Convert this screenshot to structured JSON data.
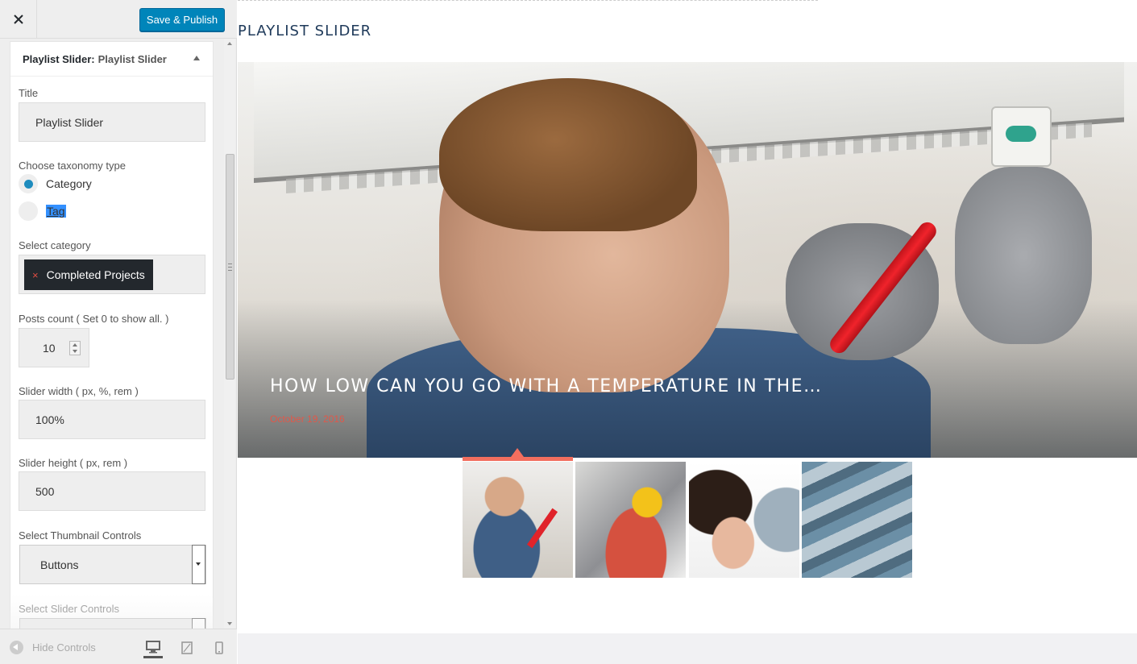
{
  "topbar": {
    "close_icon": "close-icon",
    "publish_label": "Save & Publish"
  },
  "widget": {
    "type_label": "Playlist Slider:",
    "title_label": "Playlist Slider",
    "fields": {
      "title_label": "Title",
      "title_value": "Playlist Slider",
      "taxonomy_label": "Choose taxonomy type",
      "taxonomy_options": [
        "Category",
        "Tag"
      ],
      "taxonomy_selected": "Category",
      "category_label": "Select category",
      "category_chip": "Completed Projects",
      "category_chip_remove": "×",
      "posts_count_label": "Posts count ( Set 0 to show all. )",
      "posts_count_value": "10",
      "slider_width_label": "Slider width ( px, %, rem )",
      "slider_width_value": "100%",
      "slider_height_label": "Slider height ( px, rem )",
      "slider_height_value": "500",
      "thumb_controls_label": "Select Thumbnail Controls",
      "thumb_controls_value": "Buttons",
      "slider_controls_label": "Select Slider Controls"
    }
  },
  "footer": {
    "hide_controls_label": "Hide Controls",
    "devices": [
      "desktop-icon",
      "tablet-icon",
      "mobile-icon"
    ],
    "active_device": "desktop"
  },
  "preview": {
    "section_title": "PLAYLIST SLIDER",
    "slide": {
      "caption": "HOW LOW CAN YOU GO WITH A TEMPERATURE IN THE…",
      "date": "October 19, 2016"
    },
    "thumbnails": [
      "thumb-1",
      "thumb-2",
      "thumb-3",
      "thumb-4"
    ],
    "active_thumbnail": 0,
    "accent_color": "#f26e5e"
  },
  "colors": {
    "primary_button": "#0085ba",
    "radio_selected": "#1e8cbe",
    "chip_bg": "#23282d",
    "date_color": "#e0584a"
  }
}
